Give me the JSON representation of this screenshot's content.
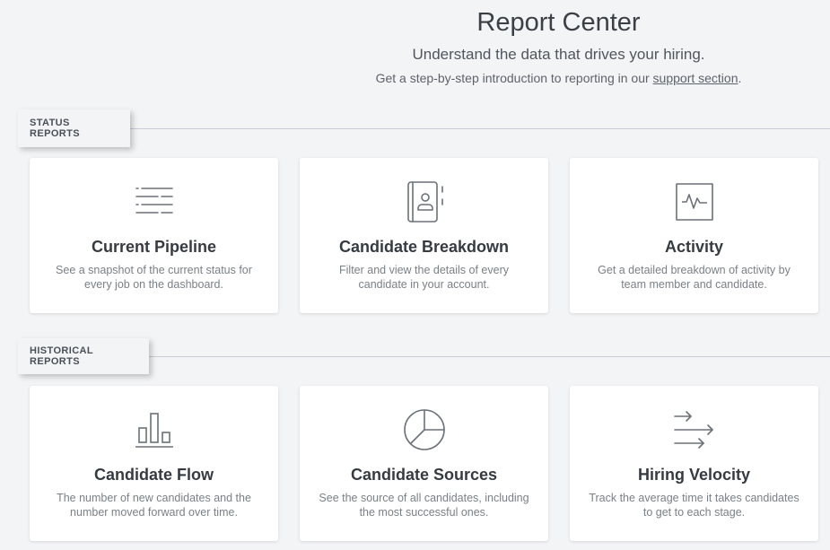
{
  "header": {
    "title": "Report Center",
    "subtitle": "Understand the data that drives your hiring.",
    "intro_prefix": "Get a step-by-step introduction to reporting in our ",
    "intro_link": "support section",
    "intro_suffix": "."
  },
  "status_reports": {
    "label": "STATUS REPORTS",
    "cards": [
      {
        "title": "Current Pipeline",
        "description": "See a snapshot of the current status for every job on the dashboard.",
        "icon": "pipeline-lines-icon"
      },
      {
        "title": "Candidate Breakdown",
        "description": "Filter and view the details of every candidate in your account.",
        "icon": "address-book-icon"
      },
      {
        "title": "Activity",
        "description": "Get a detailed breakdown of activity by team member and candidate.",
        "icon": "activity-pulse-icon"
      }
    ]
  },
  "historical_reports": {
    "label": "HISTORICAL REPORTS",
    "cards": [
      {
        "title": "Candidate Flow",
        "description": "The number of new candidates and the number moved forward over time.",
        "icon": "bar-chart-icon"
      },
      {
        "title": "Candidate Sources",
        "description": "See the source of all candidates, including the most successful ones.",
        "icon": "pie-chart-icon"
      },
      {
        "title": "Hiring Velocity",
        "description": "Track the average time it takes candidates to get to each stage.",
        "icon": "arrows-right-icon"
      }
    ]
  },
  "colors": {
    "background": "#f3f4f5",
    "card": "#ffffff",
    "icon_stroke": "#6b7178",
    "text_primary": "#363b42",
    "text_secondary": "#7a8087"
  }
}
